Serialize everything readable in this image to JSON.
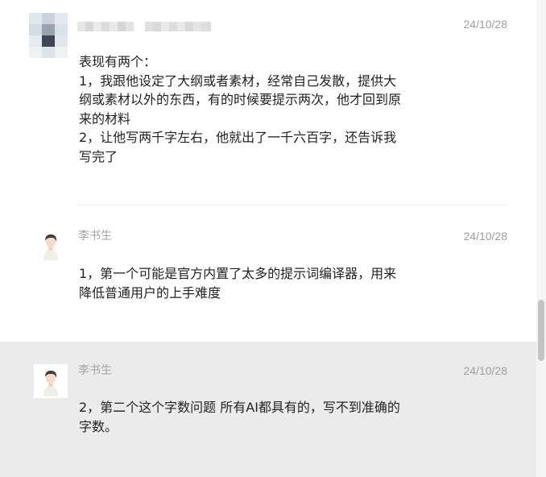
{
  "messages": [
    {
      "sender": "",
      "time": "24/10/28",
      "text": "表现有两个：\n1，我跟他设定了大纲或者素材，经常自己发散，提供大\n纲或素材以外的东西，有的时候要提示两次，他才回到原\n来的材料\n2，让他写两千字左右，他就出了一千六百字，还告诉我\n写完了"
    },
    {
      "sender": "李书生",
      "time": "24/10/28",
      "text": "1，第一个可能是官方内置了太多的提示词编译器，用来\n降低普通用户的上手难度"
    },
    {
      "sender": "李书生",
      "time": "24/10/28",
      "text": "2，第二个这个字数问题 所有AI都具有的，写不到准确的\n字数。"
    }
  ],
  "icons": {
    "avatar_blurred": "blurred-avatar-icon",
    "avatar_person": "person-avatar-icon"
  },
  "colors": {
    "highlight_bg": "#ebebeb",
    "meta_text": "#a3a3a3",
    "body_text": "#222222"
  }
}
